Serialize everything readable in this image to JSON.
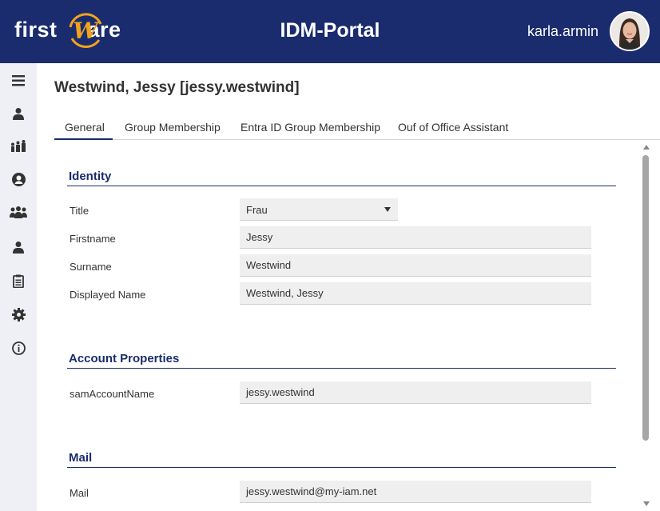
{
  "header": {
    "logo_text_left": "first",
    "logo_text_right": "are",
    "logo_letter": "W",
    "app_title": "IDM-Portal",
    "username": "karla.armin",
    "bg_color": "#1a2c6e",
    "logo_accent": "#f2a31b"
  },
  "sidebar": {
    "items": [
      {
        "icon": "menu-icon"
      },
      {
        "icon": "user-icon"
      },
      {
        "icon": "group-icon"
      },
      {
        "icon": "account-circle-icon"
      },
      {
        "icon": "team-icon"
      },
      {
        "icon": "person-icon"
      },
      {
        "icon": "clipboard-icon"
      },
      {
        "icon": "gear-icon"
      },
      {
        "icon": "info-icon"
      }
    ]
  },
  "page": {
    "title": "Westwind, Jessy [jessy.westwind]"
  },
  "tabs": [
    {
      "label": "General",
      "active": true
    },
    {
      "label": "Group Membership",
      "active": false
    },
    {
      "label": "Entra ID Group Membership",
      "active": false
    },
    {
      "label": "Ouf of Office Assistant",
      "active": false
    }
  ],
  "sections": {
    "identity": {
      "title": "Identity",
      "title_field": {
        "label": "Title",
        "value": "Frau"
      },
      "firstname": {
        "label": "Firstname",
        "value": "Jessy"
      },
      "surname": {
        "label": "Surname",
        "value": "Westwind"
      },
      "displayed_name": {
        "label": "Displayed Name",
        "value": "Westwind, Jessy"
      }
    },
    "account": {
      "title": "Account Properties",
      "sam": {
        "label": "samAccountName",
        "value": "jessy.westwind"
      }
    },
    "mail": {
      "title": "Mail",
      "mail": {
        "label": "Mail",
        "value": "jessy.westwind@my-iam.net"
      }
    }
  }
}
